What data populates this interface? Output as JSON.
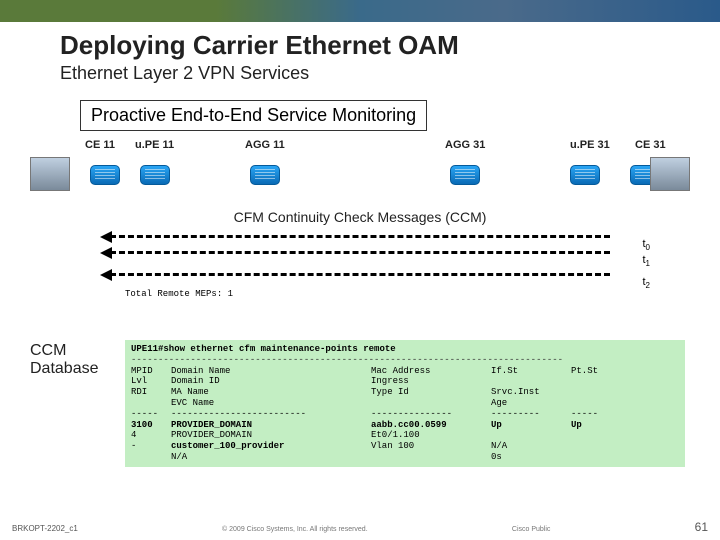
{
  "header": {
    "title": "Deploying Carrier Ethernet OAM",
    "subtitle": "Ethernet Layer 2 VPN Services"
  },
  "band": "Proactive End-to-End Service Monitoring",
  "devices": {
    "ce11": "CE 11",
    "upe11": "u.PE 11",
    "agg11": "AGG 11",
    "agg31": "AGG 31",
    "upe31": "u.PE 31",
    "ce31": "CE 31"
  },
  "cfm_title": "CFM Continuity Check Messages (CCM)",
  "time_labels": {
    "t0": "t",
    "t0s": "0",
    "t1": "t",
    "t1s": "1",
    "t2": "t",
    "t2s": "2"
  },
  "ccm_label1": "CCM",
  "ccm_label2": "Database",
  "terminal": {
    "prompt_host": "UPE11#",
    "prompt_cmd": "show ethernet cfm maintenance-points remote",
    "sep_long": "--------------------------------------------------------------------------------",
    "hdr_c1a": "MPID",
    "hdr_c1b": "Lvl",
    "hdr_c1c": "RDI",
    "hdr_c2a": "Domain Name",
    "hdr_c2b": "Domain ID",
    "hdr_c2c": "MA Name",
    "hdr_c2d": "EVC Name",
    "hdr_c3a": "Mac Address",
    "hdr_c3b": "Ingress",
    "hdr_c3c": "Type Id",
    "hdr_c4a": "If.St",
    "hdr_c4c": "Srvc.Inst",
    "hdr_c4d": "Age",
    "hdr_c5a": "Pt.St",
    "sep_c1": "-----",
    "sep_c2": "-------------------------",
    "sep_c3": "---------------",
    "sep_c4": "---------",
    "sep_c5": "-----",
    "d_c1a": "3100",
    "d_c1b": "4",
    "d_c1c": "-",
    "d_c2a": "PROVIDER_DOMAIN",
    "d_c2b": "PROVIDER_DOMAIN",
    "d_c2c": "customer_100_provider",
    "d_c2d": "N/A",
    "d_c3a": "aabb.cc00.0599",
    "d_c3b": "Et0/1.100",
    "d_c3c": "Vlan 100",
    "d_c4a": "Up",
    "d_c4c": "N/A",
    "d_c4d": "0s",
    "d_c5a": "Up"
  },
  "total_line": "Total Remote MEPs: 1",
  "footer": {
    "left": "BRKOPT-2202_c1",
    "copyright": "© 2009 Cisco Systems, Inc. All rights reserved.",
    "classification": "Cisco Public",
    "page": "61"
  }
}
